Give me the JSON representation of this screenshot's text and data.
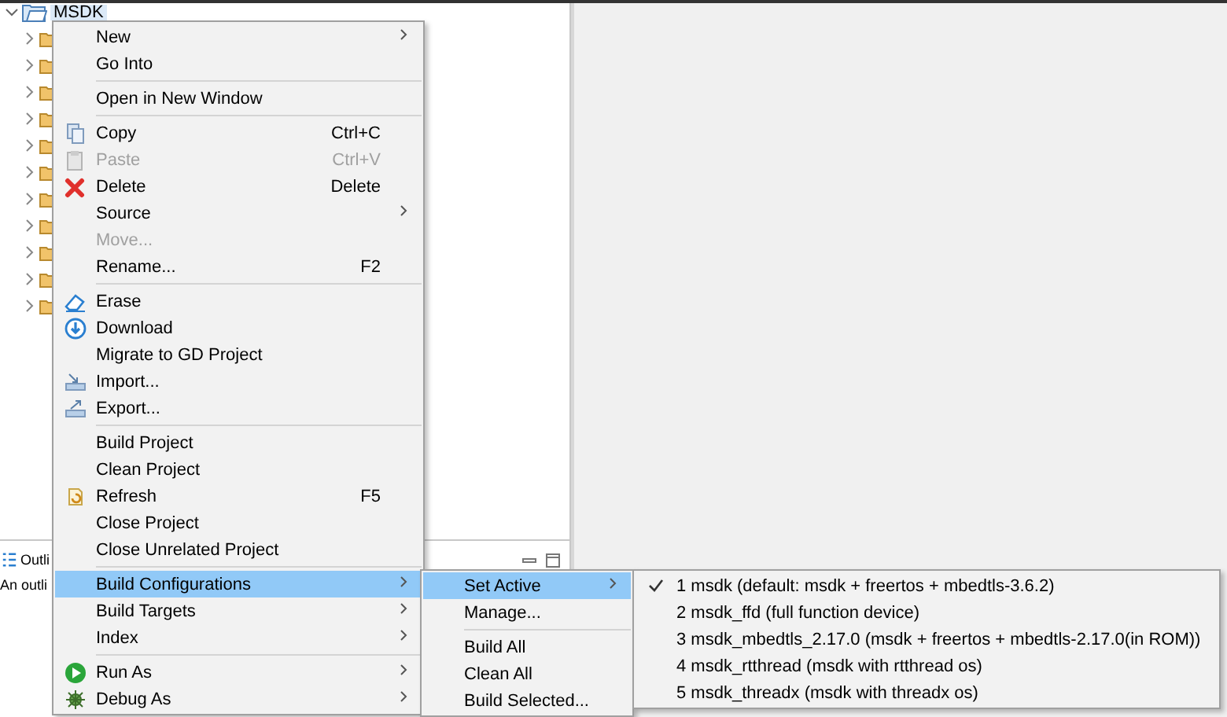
{
  "explorer": {
    "root": {
      "label": "MSDK",
      "expanded": true,
      "children": [
        {
          "expanded": false
        },
        {
          "expanded": false
        },
        {
          "expanded": false
        },
        {
          "expanded": false
        },
        {
          "expanded": false
        },
        {
          "expanded": false
        },
        {
          "expanded": false
        },
        {
          "expanded": false
        },
        {
          "expanded": false
        },
        {
          "expanded": false
        },
        {
          "expanded": false
        }
      ]
    }
  },
  "outline": {
    "tab": "Outli",
    "message": "An outli"
  },
  "context_menu": {
    "items": [
      {
        "kind": "item",
        "label": "New",
        "submenu": true,
        "disabled": false,
        "selected": false
      },
      {
        "kind": "item",
        "label": "Go Into",
        "submenu": false,
        "disabled": false,
        "selected": false
      },
      {
        "kind": "separator"
      },
      {
        "kind": "item",
        "label": "Open in New Window",
        "submenu": false,
        "disabled": false,
        "selected": false
      },
      {
        "kind": "separator"
      },
      {
        "kind": "item",
        "label": "Copy",
        "shortcut": "Ctrl+C",
        "submenu": false,
        "disabled": false,
        "selected": false
      },
      {
        "kind": "item",
        "label": "Paste",
        "shortcut": "Ctrl+V",
        "submenu": false,
        "disabled": true,
        "selected": false
      },
      {
        "kind": "item",
        "label": "Delete",
        "shortcut": "Delete",
        "submenu": false,
        "disabled": false,
        "selected": false
      },
      {
        "kind": "item",
        "label": "Source",
        "submenu": true,
        "disabled": false,
        "selected": false
      },
      {
        "kind": "item",
        "label": "Move...",
        "submenu": false,
        "disabled": true,
        "selected": false
      },
      {
        "kind": "item",
        "label": "Rename...",
        "shortcut": "F2",
        "submenu": false,
        "disabled": false,
        "selected": false
      },
      {
        "kind": "separator"
      },
      {
        "kind": "item",
        "label": "Erase",
        "submenu": false,
        "disabled": false,
        "selected": false
      },
      {
        "kind": "item",
        "label": "Download",
        "submenu": false,
        "disabled": false,
        "selected": false
      },
      {
        "kind": "item",
        "label": "Migrate to GD Project",
        "submenu": false,
        "disabled": false,
        "selected": false
      },
      {
        "kind": "item",
        "label": "Import...",
        "submenu": false,
        "disabled": false,
        "selected": false
      },
      {
        "kind": "item",
        "label": "Export...",
        "submenu": false,
        "disabled": false,
        "selected": false
      },
      {
        "kind": "separator"
      },
      {
        "kind": "item",
        "label": "Build Project",
        "submenu": false,
        "disabled": false,
        "selected": false
      },
      {
        "kind": "item",
        "label": "Clean Project",
        "submenu": false,
        "disabled": false,
        "selected": false
      },
      {
        "kind": "item",
        "label": "Refresh",
        "shortcut": "F5",
        "submenu": false,
        "disabled": false,
        "selected": false
      },
      {
        "kind": "item",
        "label": "Close Project",
        "submenu": false,
        "disabled": false,
        "selected": false
      },
      {
        "kind": "item",
        "label": "Close Unrelated Project",
        "submenu": false,
        "disabled": false,
        "selected": false
      },
      {
        "kind": "separator"
      },
      {
        "kind": "item",
        "label": "Build Configurations",
        "submenu": true,
        "disabled": false,
        "selected": true
      },
      {
        "kind": "item",
        "label": "Build Targets",
        "submenu": true,
        "disabled": false,
        "selected": false
      },
      {
        "kind": "item",
        "label": "Index",
        "submenu": true,
        "disabled": false,
        "selected": false
      },
      {
        "kind": "separator"
      },
      {
        "kind": "item",
        "label": "Run As",
        "submenu": true,
        "disabled": false,
        "selected": false
      },
      {
        "kind": "item",
        "label": "Debug As",
        "submenu": true,
        "disabled": false,
        "selected": false
      }
    ]
  },
  "build_configurations_menu": {
    "items": [
      {
        "kind": "item",
        "label": "Set Active",
        "submenu": true,
        "disabled": false,
        "selected": true
      },
      {
        "kind": "item",
        "label": "Manage...",
        "submenu": false,
        "disabled": false,
        "selected": false
      },
      {
        "kind": "separator"
      },
      {
        "kind": "item",
        "label": "Build All",
        "submenu": false,
        "disabled": false,
        "selected": false
      },
      {
        "kind": "item",
        "label": "Clean All",
        "submenu": false,
        "disabled": false,
        "selected": false
      },
      {
        "kind": "item",
        "label": "Build Selected...",
        "submenu": false,
        "disabled": false,
        "selected": false
      }
    ]
  },
  "set_active_menu": {
    "items": [
      {
        "kind": "item",
        "label": "1 msdk (default: msdk + freertos + mbedtls-3.6.2)",
        "checked": true,
        "selected": false
      },
      {
        "kind": "item",
        "label": "2 msdk_ffd (full function device)",
        "checked": false,
        "selected": false
      },
      {
        "kind": "item",
        "label": "3 msdk_mbedtls_2.17.0 (msdk + freertos + mbedtls-2.17.0(in ROM))",
        "checked": false,
        "selected": false
      },
      {
        "kind": "item",
        "label": "4 msdk_rtthread (msdk with rtthread os)",
        "checked": false,
        "selected": false
      },
      {
        "kind": "item",
        "label": "5 msdk_threadx (msdk with threadx os)",
        "checked": false,
        "selected": false
      }
    ]
  }
}
